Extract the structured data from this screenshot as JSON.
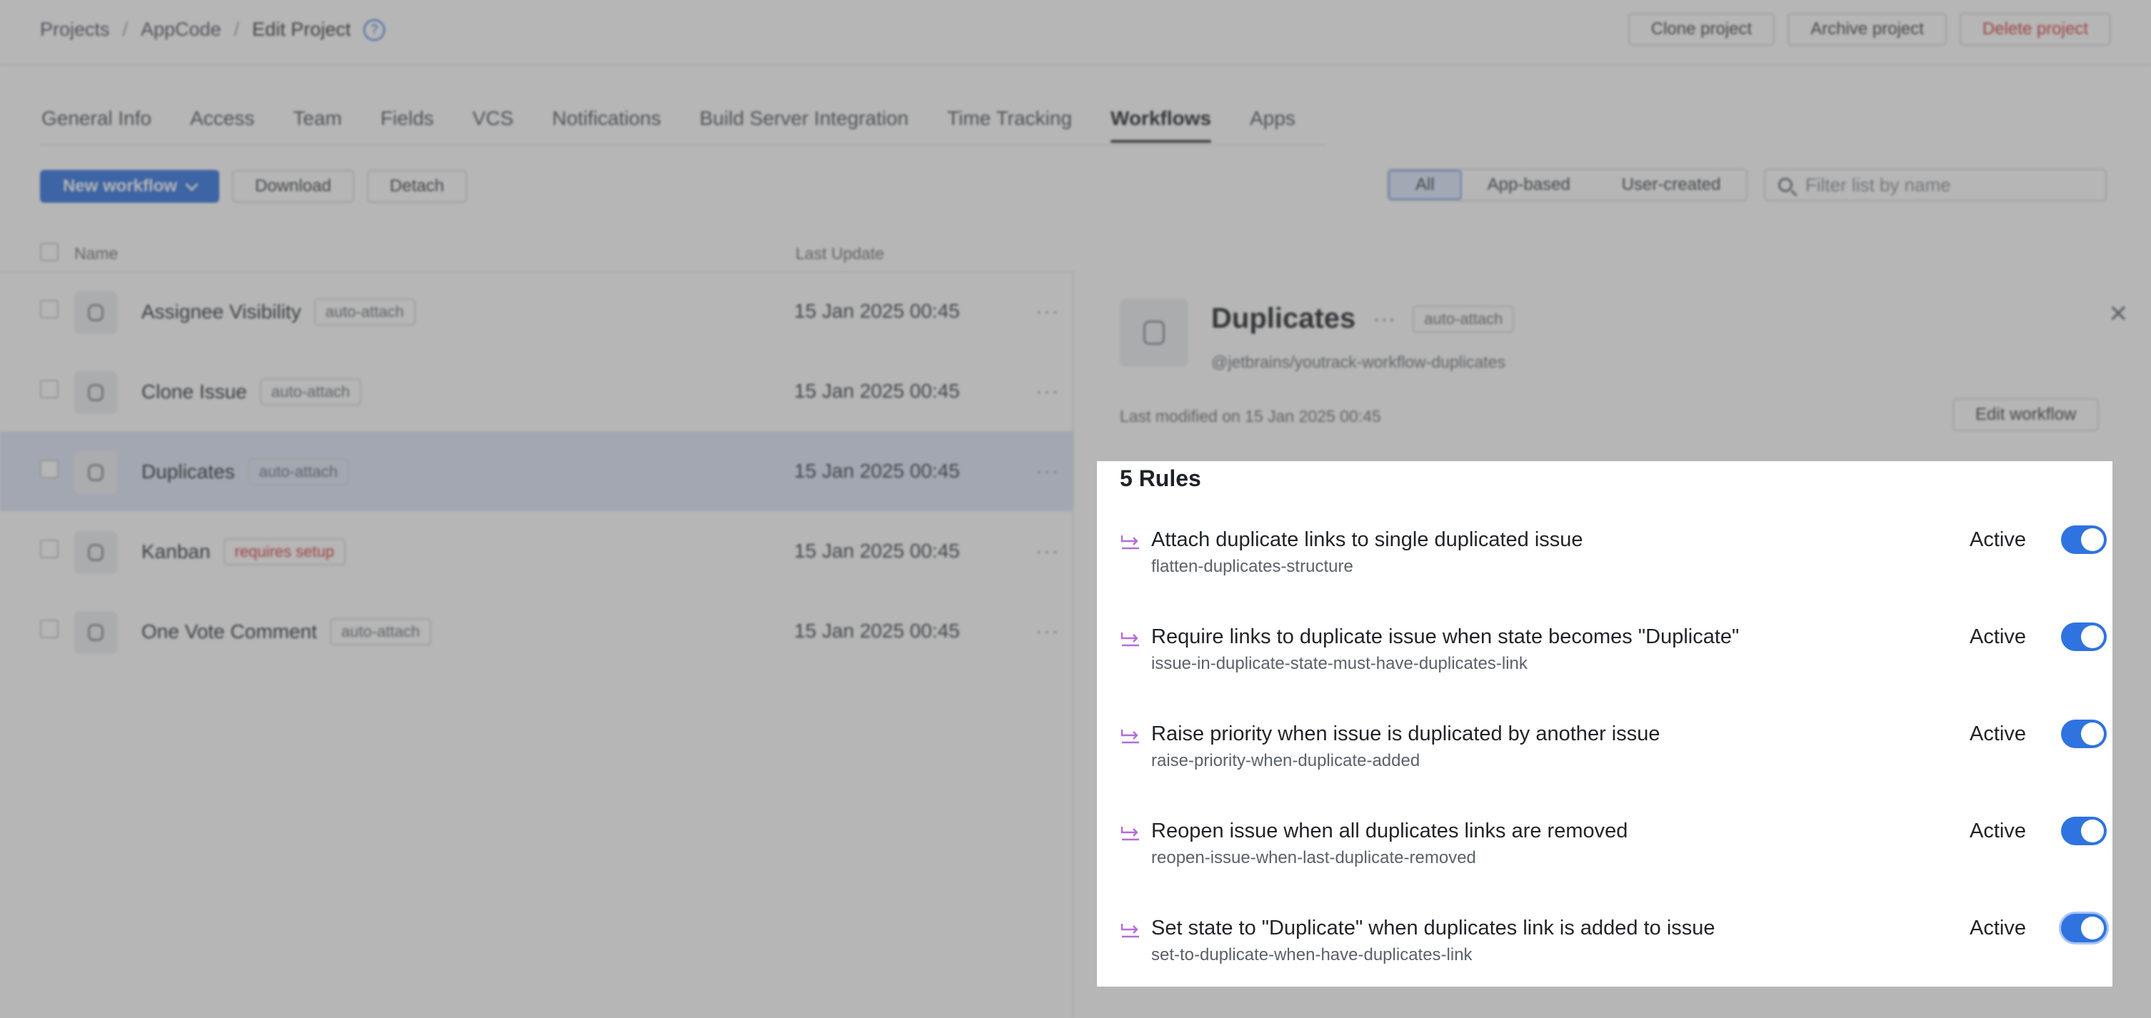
{
  "breadcrumb": {
    "items": [
      "Projects",
      "AppCode",
      "Edit Project"
    ],
    "separator": "/",
    "help_icon": "question-circle-icon"
  },
  "header_actions": {
    "clone": "Clone project",
    "archive": "Archive project",
    "delete": "Delete project"
  },
  "tabs": [
    {
      "label": "General Info",
      "active": false
    },
    {
      "label": "Access",
      "active": false
    },
    {
      "label": "Team",
      "active": false
    },
    {
      "label": "Fields",
      "active": false
    },
    {
      "label": "VCS",
      "active": false
    },
    {
      "label": "Notifications",
      "active": false
    },
    {
      "label": "Build Server Integration",
      "active": false
    },
    {
      "label": "Time Tracking",
      "active": false
    },
    {
      "label": "Workflows",
      "active": true
    },
    {
      "label": "Apps",
      "active": false
    }
  ],
  "toolbar": {
    "new_workflow": "New workflow",
    "download": "Download",
    "detach": "Detach"
  },
  "filter": {
    "segments": [
      "All",
      "App-based",
      "User-created"
    ],
    "selected": "All",
    "search_placeholder": "Filter list by name"
  },
  "list": {
    "columns": {
      "name": "Name",
      "last_update": "Last Update"
    },
    "rows": [
      {
        "name": "Assignee Visibility",
        "tag": "auto-attach",
        "date": "15 Jan 2025 00:45"
      },
      {
        "name": "Clone Issue",
        "tag": "auto-attach",
        "date": "15 Jan 2025 00:45"
      },
      {
        "name": "Duplicates",
        "tag": "auto-attach",
        "date": "15 Jan 2025 00:45",
        "selected": true
      },
      {
        "name": "Kanban",
        "tag": "requires setup",
        "date": "15 Jan 2025 00:45"
      },
      {
        "name": "One Vote Comment",
        "tag": "auto-attach",
        "date": "15 Jan 2025 00:45"
      }
    ],
    "more": "···"
  },
  "detail": {
    "title": "Duplicates",
    "dots": "···",
    "tag": "auto-attach",
    "package": "@jetbrains/youtrack-workflow-duplicates",
    "last_modified": "Last modified on 15 Jan 2025 00:45",
    "edit_button": "Edit workflow",
    "close": "✕"
  },
  "rules": {
    "heading": "5 Rules",
    "items": [
      {
        "title": "Attach duplicate links to single duplicated issue",
        "id": "flatten-duplicates-structure",
        "status": "Active",
        "enabled": true
      },
      {
        "title": "Require links to duplicate issue when state becomes \"Duplicate\"",
        "id": "issue-in-duplicate-state-must-have-duplicates-link",
        "status": "Active",
        "enabled": true
      },
      {
        "title": "Raise priority when issue is duplicated by another issue",
        "id": "raise-priority-when-duplicate-added",
        "status": "Active",
        "enabled": true
      },
      {
        "title": "Reopen issue when all duplicates links are removed",
        "id": "reopen-issue-when-last-duplicate-removed",
        "status": "Active",
        "enabled": true
      },
      {
        "title": "Set state to \"Duplicate\" when duplicates link is added to issue",
        "id": "set-to-duplicate-when-have-duplicates-link",
        "status": "Active",
        "enabled": true
      }
    ]
  },
  "colors": {
    "accent": "#2f73e0",
    "rule_icon": "#b46cd8",
    "danger": "#d33a3a",
    "selected_row": "#dde6f6"
  }
}
